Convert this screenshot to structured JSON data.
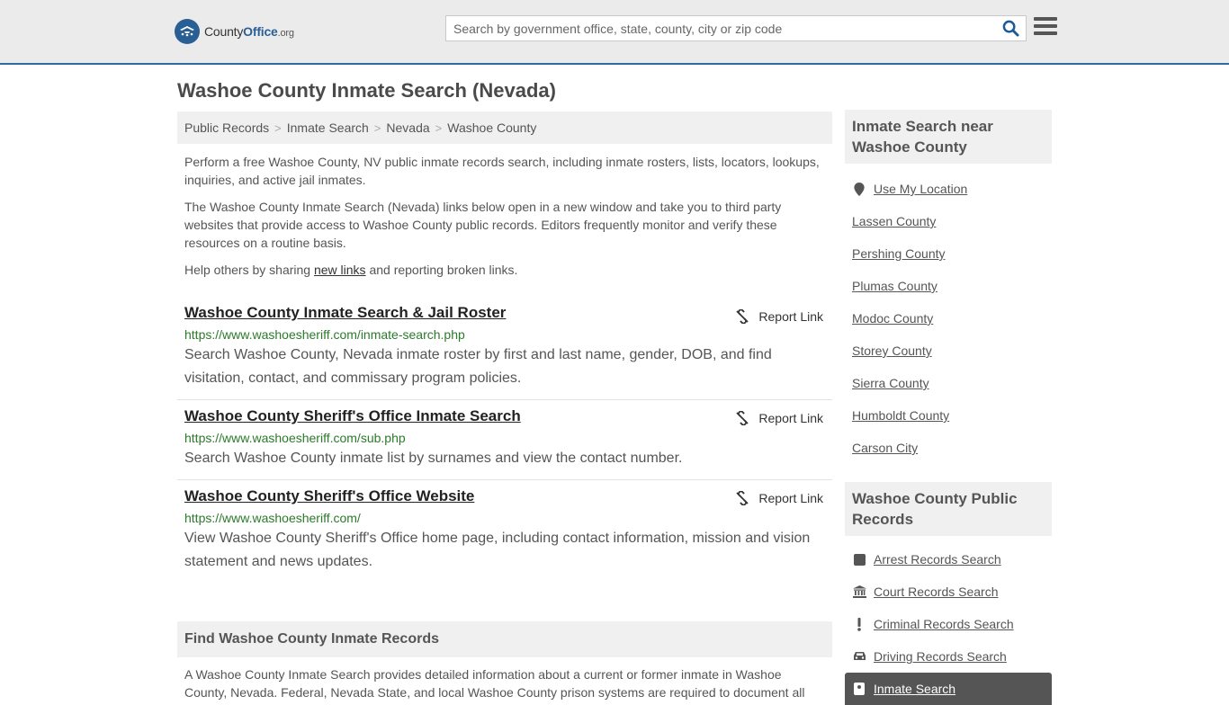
{
  "header": {
    "logo_county": "County",
    "logo_office": "Office",
    "logo_org": ".org",
    "search_placeholder": "Search by government office, state, county, city or zip code"
  },
  "page": {
    "title": "Washoe County Inmate Search (Nevada)"
  },
  "breadcrumb": [
    "Public Records",
    "Inmate Search",
    "Nevada",
    "Washoe County"
  ],
  "intro": {
    "p1": "Perform a free Washoe County, NV public inmate records search, including inmate rosters, lists, locators, lookups, inquiries, and active jail inmates.",
    "p2": "The Washoe County Inmate Search (Nevada) links below open in a new window and take you to third party websites that provide access to Washoe County public records. Editors frequently monitor and verify these resources on a routine basis.",
    "p3_before": "Help others by sharing ",
    "p3_link": "new links",
    "p3_after": " and reporting broken links."
  },
  "report_label": "Report Link",
  "results": [
    {
      "title": "Washoe County Inmate Search & Jail Roster",
      "url": "https://www.washoesheriff.com/inmate-search.php",
      "desc": "Search Washoe County, Nevada inmate roster by first and last name, gender, DOB, and find visitation, contact, and commissary program policies."
    },
    {
      "title": "Washoe County Sheriff's Office Inmate Search",
      "url": "https://www.washoesheriff.com/sub.php",
      "desc": "Search Washoe County inmate list by surnames and view the contact number."
    },
    {
      "title": "Washoe County Sheriff's Office Website",
      "url": "https://www.washoesheriff.com/",
      "desc": "View Washoe County Sheriff's Office home page, including contact information, mission and vision statement and news updates."
    }
  ],
  "find_section": {
    "title": "Find Washoe County Inmate Records",
    "text": "A Washoe County Inmate Search provides detailed information about a current or former inmate in Washoe County, Nevada. Federal, Nevada State, and local Washoe County prison systems are required to document all"
  },
  "sidebar": {
    "nearby_title": "Inmate Search near Washoe County",
    "use_location": "Use My Location",
    "nearby": [
      "Lassen County",
      "Pershing County",
      "Plumas County",
      "Modoc County",
      "Storey County",
      "Sierra County",
      "Humboldt County",
      "Carson City"
    ],
    "records_title": "Washoe County Public Records",
    "records": [
      {
        "label": "Arrest Records Search",
        "icon": "square-icon"
      },
      {
        "label": "Court Records Search",
        "icon": "courthouse-icon"
      },
      {
        "label": "Criminal Records Search",
        "icon": "exclamation-icon"
      },
      {
        "label": "Driving Records Search",
        "icon": "car-icon"
      }
    ],
    "active_record": {
      "label": "Inmate Search",
      "icon": "inmate-icon"
    }
  },
  "colors": {
    "header_bg": "#ebebeb",
    "header_border": "#2f6aa3",
    "url_green": "#2b7a2b",
    "search_icon_blue": "#1a5a9a",
    "active_bg": "#555555"
  }
}
